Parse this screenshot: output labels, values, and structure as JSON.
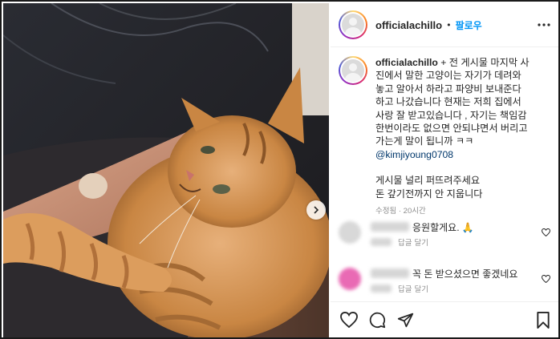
{
  "post": {
    "username": "officialachillo",
    "follow_separator": "•",
    "follow_label": "팔로우",
    "caption_username": "officialachillo",
    "caption_lines": [
      "+ 전 게시물 마지막 사",
      "진에서 말한 고양이는 자기가 데려와",
      "놓고 알아서 하라고 파양비 보내준다",
      "하고 나갔습니다 현재는 저희 집에서",
      "사랑 잘 받고있습니다 , 자기는 책임감",
      "한번이라도 없으면 안되냐면서 버리고",
      "가는게 말이 됩니까 ㅋㅋ"
    ],
    "mention": "@kimjiyoung0708",
    "closing_lines": [
      "게시물 널리 퍼뜨려주세요",
      "돈 갚기전까지 안 지웁니다"
    ],
    "meta": "수정됨 · 20시간"
  },
  "comments": [
    {
      "text": "응원할게요. 🙏",
      "reply_label": "답글 달기",
      "avatar_color": "#d8d8d8"
    },
    {
      "text": "꼭 돈 받으셨으면 좋겠네요",
      "reply_label": "답글 달기",
      "avatar_color": "#e96ab4"
    }
  ],
  "icons": {
    "more": "more-options-icon",
    "next": "chevron-right-icon",
    "like": "heart-icon",
    "comment": "comment-icon",
    "share": "share-icon",
    "save": "bookmark-icon"
  },
  "colors": {
    "accent": "#0095f6",
    "mention": "#00376b",
    "muted": "#8e8e8e"
  }
}
